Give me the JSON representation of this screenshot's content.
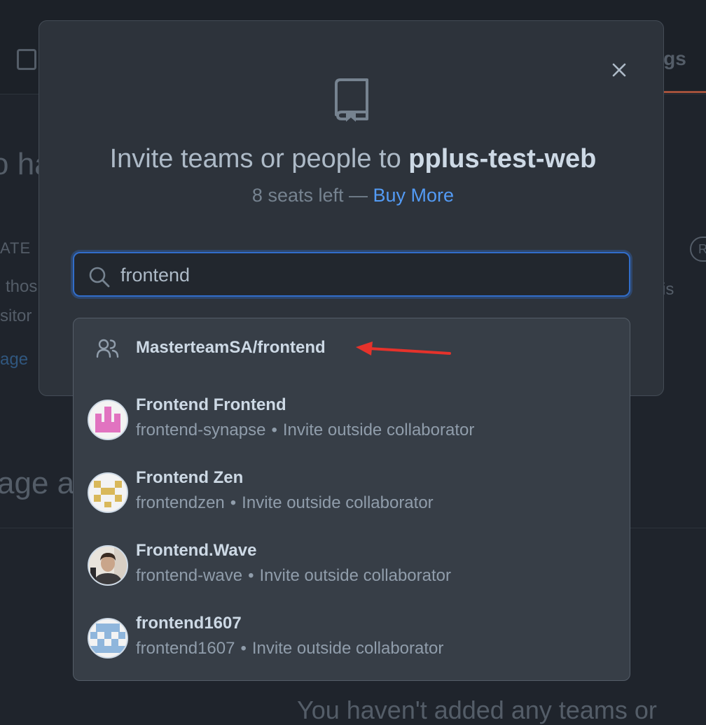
{
  "background": {
    "tab_fragment": "ngs",
    "heading_fragment": "o ha",
    "section_label_fragment": "ATE",
    "text_fragment_1": "thos",
    "text_fragment_2": "sitor",
    "link_fragment": "age",
    "text_fragment_3": "is",
    "pill_fragment": "R",
    "manage_heading_fragment": "age a",
    "empty_state_fragment": "You haven't added any teams or"
  },
  "modal": {
    "title_prefix": "Invite teams or people to ",
    "repo_name": "pplus-test-web",
    "seats_text": "8 seats left —",
    "buy_more_label": "Buy More",
    "close_icon": "x-icon",
    "repo_icon": "repo-icon"
  },
  "search": {
    "value": "frontend",
    "icon": "search-icon"
  },
  "results": {
    "team": {
      "name": "MasterteamSA/frontend",
      "icon": "people-icon"
    },
    "users": [
      {
        "name": "Frontend Frontend",
        "login": "frontend-synapse",
        "separator": "•",
        "action": "Invite outside collaborator",
        "avatar_color": "#e173c0"
      },
      {
        "name": "Frontend Zen",
        "login": "frontendzen",
        "separator": "•",
        "action": "Invite outside collaborator",
        "avatar_color": "#d9b85a"
      },
      {
        "name": "Frontend.Wave",
        "login": "frontend-wave",
        "separator": "•",
        "action": "Invite outside collaborator",
        "avatar_color": "#6b5a4e"
      },
      {
        "name": "frontend1607",
        "login": "frontend1607",
        "separator": "•",
        "action": "Invite outside collaborator",
        "avatar_color": "#8fb6dc"
      }
    ]
  },
  "colors": {
    "accent_link": "#539bf5",
    "focus_border": "#316dca",
    "annotation_arrow": "#e5322b"
  }
}
